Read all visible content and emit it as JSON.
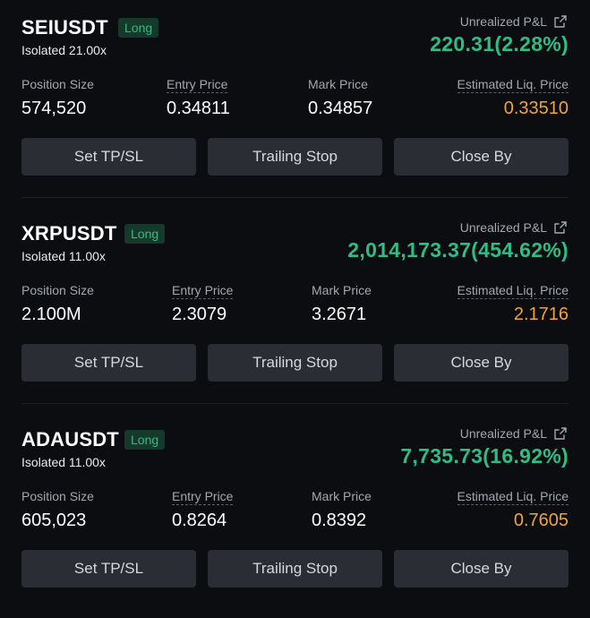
{
  "positions": [
    {
      "symbol": "SEIUSDT",
      "side": "Long",
      "margin_mode": "Isolated 21.00x",
      "pnl_label": "Unrealized P&L",
      "pnl_value": "220.31(2.28%)",
      "position_size_label": "Position Size",
      "position_size": "574,520",
      "entry_price_label": "Entry Price",
      "entry_price": "0.34811",
      "mark_price_label": "Mark Price",
      "mark_price": "0.34857",
      "liq_price_label": "Estimated Liq. Price",
      "liq_price": "0.33510",
      "btn_tpsl": "Set TP/SL",
      "btn_trailing": "Trailing Stop",
      "btn_close": "Close By"
    },
    {
      "symbol": "XRPUSDT",
      "side": "Long",
      "margin_mode": "Isolated 11.00x",
      "pnl_label": "Unrealized P&L",
      "pnl_value": "2,014,173.37(454.62%)",
      "position_size_label": "Position Size",
      "position_size": "2.100M",
      "entry_price_label": "Entry Price",
      "entry_price": "2.3079",
      "mark_price_label": "Mark Price",
      "mark_price": "3.2671",
      "liq_price_label": "Estimated Liq. Price",
      "liq_price": "2.1716",
      "btn_tpsl": "Set TP/SL",
      "btn_trailing": "Trailing Stop",
      "btn_close": "Close By"
    },
    {
      "symbol": "ADAUSDT",
      "side": "Long",
      "margin_mode": "Isolated 11.00x",
      "pnl_label": "Unrealized P&L",
      "pnl_value": "7,735.73(16.92%)",
      "position_size_label": "Position Size",
      "position_size": "605,023",
      "entry_price_label": "Entry Price",
      "entry_price": "0.8264",
      "mark_price_label": "Mark Price",
      "mark_price": "0.8392",
      "liq_price_label": "Estimated Liq. Price",
      "liq_price": "0.7605",
      "btn_tpsl": "Set TP/SL",
      "btn_trailing": "Trailing Stop",
      "btn_close": "Close By"
    }
  ],
  "colors": {
    "background": "#0c0d10",
    "profit_green": "#2ebd85",
    "liq_orange": "#f0a33c",
    "button_bg": "#2a2d33",
    "label_gray": "#a3a7af"
  },
  "icons": {
    "pnl_share": "external-link-icon"
  }
}
